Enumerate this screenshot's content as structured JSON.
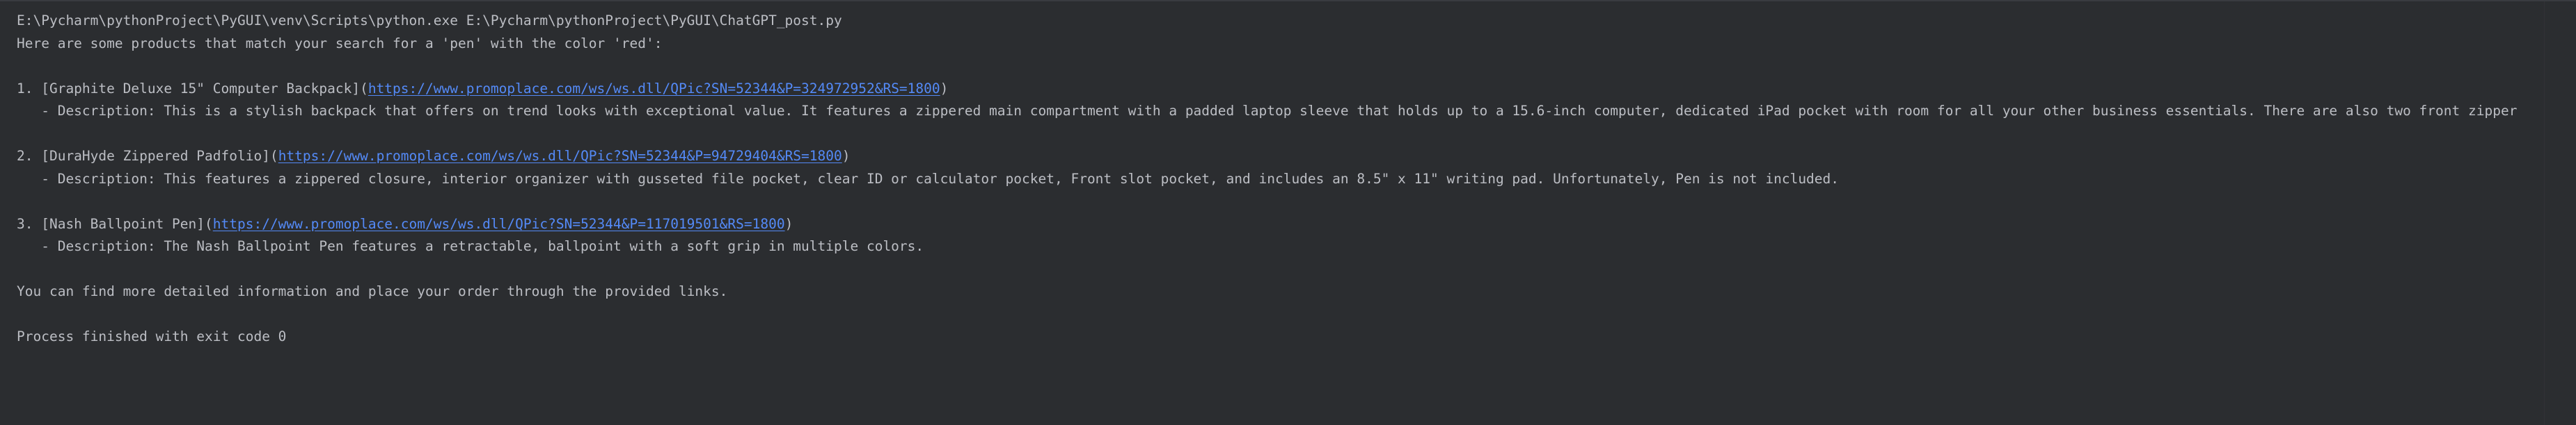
{
  "console": {
    "lines": {
      "cmd": "E:\\Pycharm\\pythonProject\\PyGUI\\venv\\Scripts\\python.exe E:\\Pycharm\\pythonProject\\PyGUI\\ChatGPT_post.py",
      "intro": "Here are some products that match your search for a 'pen' with the color 'red':",
      "item1_prefix": "1. [Graphite Deluxe 15\" Computer Backpack](",
      "item1_link": "https://www.promoplace.com/ws/ws.dll/QPic?SN=52344&P=324972952&RS=1800",
      "item1_suffix": ")",
      "item1_desc": "   - Description: This is a stylish backpack that offers on trend looks with exceptional value. It features a zippered main compartment with a padded laptop sleeve that holds up to a 15.6-inch computer, dedicated iPad pocket with room for all your other business essentials. There are also two front zipper",
      "item2_prefix": "2. [DuraHyde Zippered Padfolio](",
      "item2_link": "https://www.promoplace.com/ws/ws.dll/QPic?SN=52344&P=94729404&RS=1800",
      "item2_suffix": ")",
      "item2_desc": "   - Description: This features a zippered closure, interior organizer with gusseted file pocket, clear ID or calculator pocket, Front slot pocket, and includes an 8.5\" x 11\" writing pad. Unfortunately, Pen is not included.",
      "item3_prefix": "3. [Nash Ballpoint Pen](",
      "item3_link": "https://www.promoplace.com/ws/ws.dll/QPic?SN=52344&P=117019501&RS=1800",
      "item3_suffix": ")",
      "item3_desc": "   - Description: The Nash Ballpoint Pen features a retractable, ballpoint with a soft grip in multiple colors.",
      "outro": "You can find more detailed information and place your order through the provided links.",
      "exit": "Process finished with exit code 0"
    }
  },
  "colors": {
    "background": "#2b2d30",
    "text": "#bcbec4",
    "link": "#548af7"
  }
}
